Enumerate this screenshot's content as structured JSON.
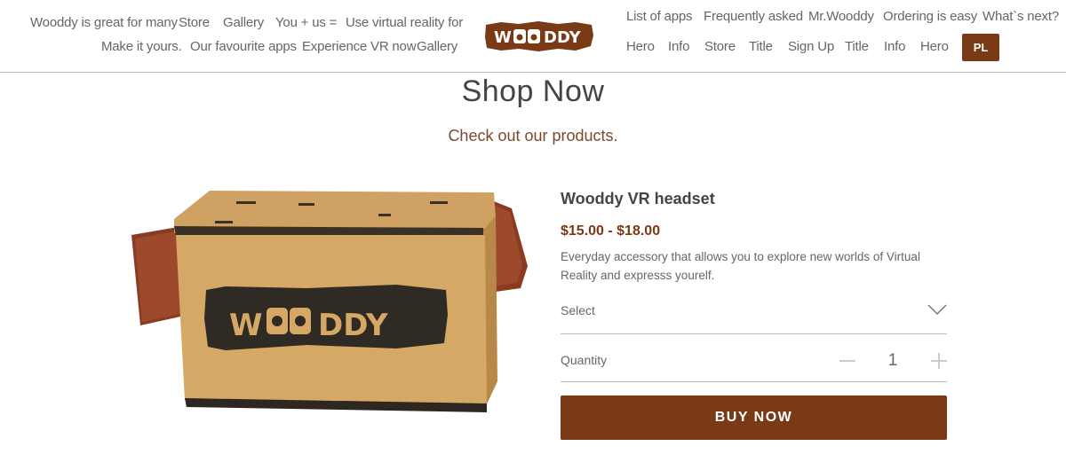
{
  "header": {
    "left_nav": [
      "Wooddy is great for many",
      "Store",
      "Gallery",
      "You + us =",
      "Use virtual reality for",
      "Make it yours.",
      "Our favourite apps",
      "Experience VR now",
      "Gallery"
    ],
    "logo_text": "W  DDY",
    "right_nav": [
      "List of apps",
      "Frequently asked",
      "Mr.Wooddy",
      "Ordering is easy",
      "What`s next?",
      "Hero",
      "Info",
      "Store",
      "Title",
      "Sign Up",
      "Title",
      "Info",
      "Hero"
    ],
    "lang_button": "PL"
  },
  "section": {
    "title": "Shop Now",
    "subtitle": "Check out our products."
  },
  "product": {
    "name": "Wooddy VR headset",
    "price": "$15.00 - $18.00",
    "description": "Everyday accessory that allows you to explore new worlds of Virtual Reality and expresss yourelf.",
    "image_logo_text": "W  DDY",
    "select_label": "Select",
    "quantity_label": "Quantity",
    "quantity_value": "1",
    "buy_button": "BUY NOW"
  },
  "colors": {
    "brand_brown": "#7a3a16",
    "text_gray": "#666666",
    "cardboard": "#d4a867"
  },
  "icons": {
    "select_chevron": "chevron-down-icon",
    "qty_minus": "minus-icon",
    "qty_plus": "plus-icon"
  }
}
